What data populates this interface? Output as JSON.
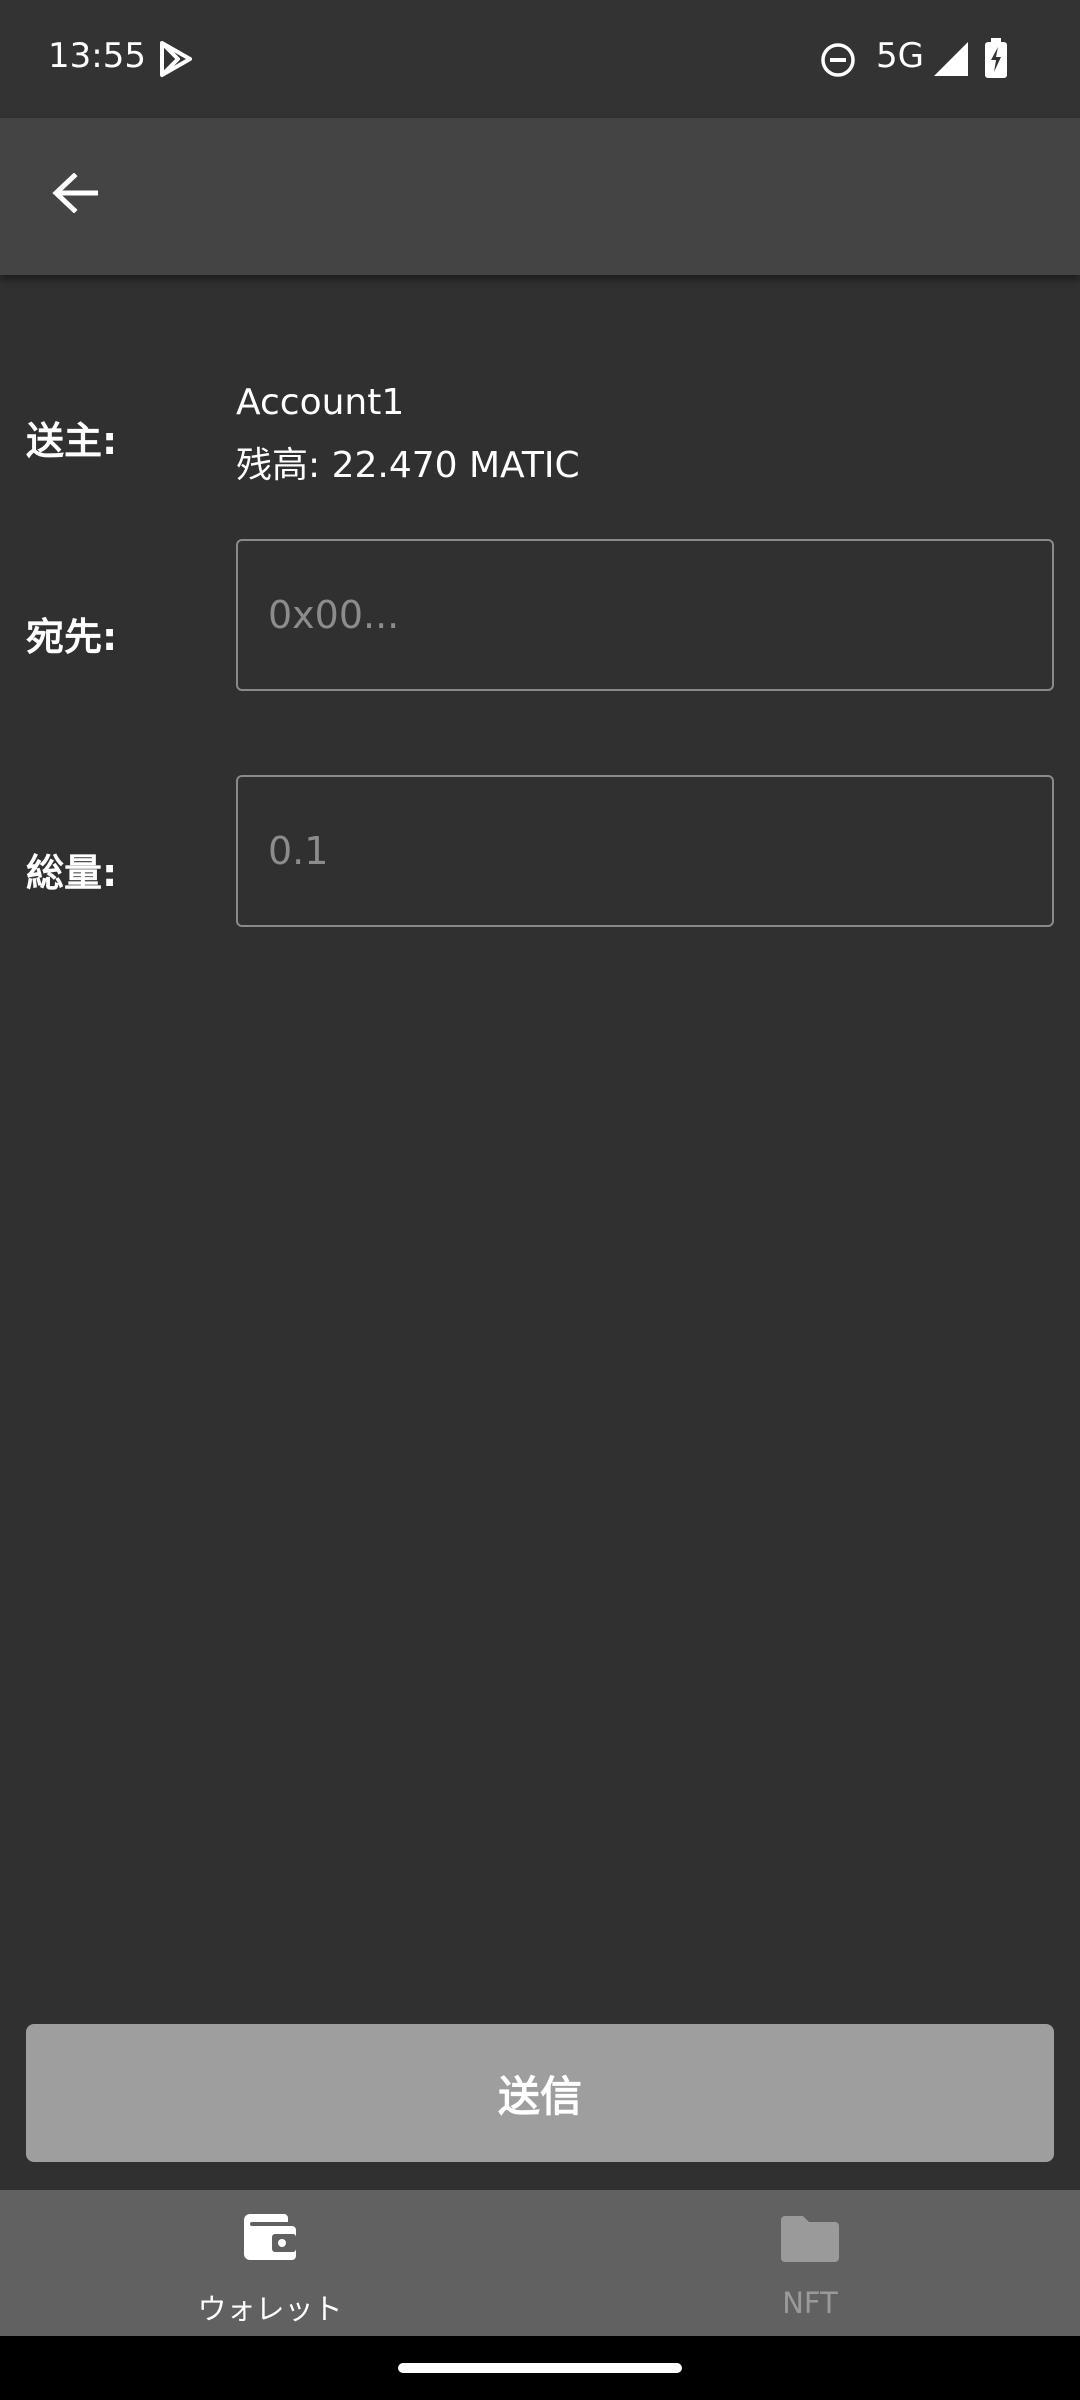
{
  "status_bar": {
    "time": "13:55",
    "network": "5G",
    "icons": [
      "play-store-icon",
      "do-not-disturb-icon",
      "signal-icon",
      "battery-charging-icon"
    ]
  },
  "app_bar": {
    "back_icon": "arrow-left-icon"
  },
  "form": {
    "sender_label": "送主:",
    "sender_name": "Account1",
    "sender_balance": "残高: 22.470 MATIC",
    "recipient_label": "宛先:",
    "recipient_placeholder": "0x00...",
    "amount_label": "総量:",
    "amount_placeholder": "0.1"
  },
  "actions": {
    "send_label": "送信"
  },
  "bottom_nav": {
    "items": [
      {
        "label": "ウォレット",
        "icon": "wallet-icon",
        "active": true
      },
      {
        "label": "NFT",
        "icon": "folder-icon",
        "active": false
      }
    ]
  },
  "colors": {
    "background": "#303030",
    "app_bar": "#444444",
    "button": "#9e9e9e",
    "nav_bar": "#616161",
    "nav_active": "#ffffff",
    "nav_inactive": "#9a9a9a"
  }
}
